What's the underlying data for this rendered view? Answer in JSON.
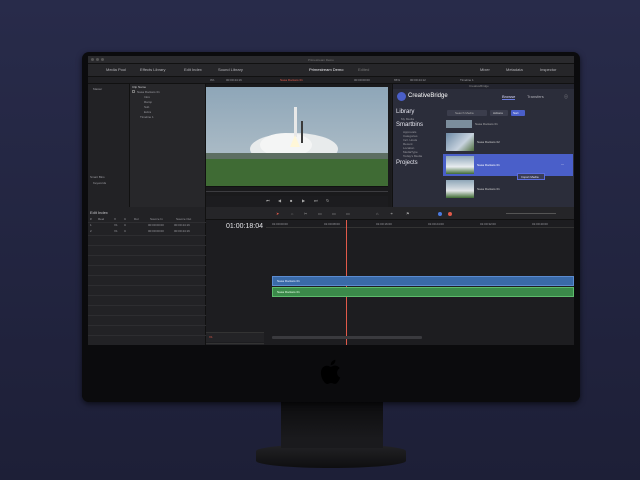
{
  "screen": {
    "titlebar": {
      "text": "Primestream Demo"
    },
    "toolbar": {
      "buttons": [
        "Media Pool",
        "Effects Library",
        "Edit Index",
        "Sound Library"
      ],
      "project_title": "Primestream Demo",
      "project_status": "Edited",
      "right_buttons": [
        "Mixer",
        "Metadata",
        "Inspector"
      ]
    },
    "infobar": {
      "zoom_left": "0%",
      "timecode_left": "00:00:44:16",
      "clip_name": "Nasa Rockets 01",
      "zoom_right": "65%",
      "timecode_mid": "00:00:00:00",
      "timecode_right": "00:00:44:12",
      "timeline_name": "Timeline 1"
    },
    "media_pool": {
      "bin_header": "Master",
      "clip_header": "Clip Name",
      "items": [
        "Nasa Rockets 01",
        "Intro",
        "Ramp",
        "Sub",
        "Extra",
        "Timeline 1"
      ],
      "smart_bins_label": "Smart Bins",
      "smart_bins_item": "Keywords"
    },
    "edit_index": {
      "title": "Edit Index",
      "columns": [
        "#",
        "Reel",
        "V",
        "C",
        "Dur",
        "Source In",
        "Source Out"
      ],
      "rows": [
        [
          "1",
          "",
          "V1",
          "C",
          "",
          "00:00:00:00",
          "00:00:44:16"
        ],
        [
          "2",
          "",
          "V1",
          "C",
          "",
          "00:00:00:00",
          "00:00:44:16"
        ]
      ]
    },
    "timeline": {
      "timecode": "01:00:18:04",
      "ruler": [
        "01:00:00:00",
        "01:00:08:00",
        "01:00:16:00",
        "01:00:24:00",
        "01:00:32:00",
        "01:00:40:00"
      ],
      "tracks": [
        {
          "name": "V1",
          "clip": "Nasa Rockets 01",
          "color": "#3a6aa8"
        },
        {
          "name": "A1",
          "clip": "Nasa Rockets 01",
          "color": "#3b8a4a"
        }
      ]
    },
    "creativebridge": {
      "title": "CreativeBridge",
      "app_name": "CreativeBridge",
      "tabs": [
        "Browse",
        "Transfers"
      ],
      "library_title": "Library",
      "library_items": [
        "My Media"
      ],
      "smartbins_title": "Smartbins",
      "smartbins_items": [
        "Approvals",
        "Categories",
        "Incr. Hosts",
        "Recent",
        "Location",
        "MediaType",
        "Today's Media"
      ],
      "projects_title": "Projects",
      "search_placeholder": "Search Media",
      "actions_label": "Actions",
      "sort_label": "Sort",
      "assets": [
        {
          "name": "Nasa Rockets 01",
          "selected": false
        },
        {
          "name": "Nasa Rockets 02",
          "selected": false
        },
        {
          "name": "Nasa Rockets 01",
          "selected": true
        },
        {
          "name": "Nasa Rockets 01",
          "selected": false
        }
      ],
      "context_menu_item": "Import Media",
      "accent_color": "#4a5fc9"
    }
  }
}
